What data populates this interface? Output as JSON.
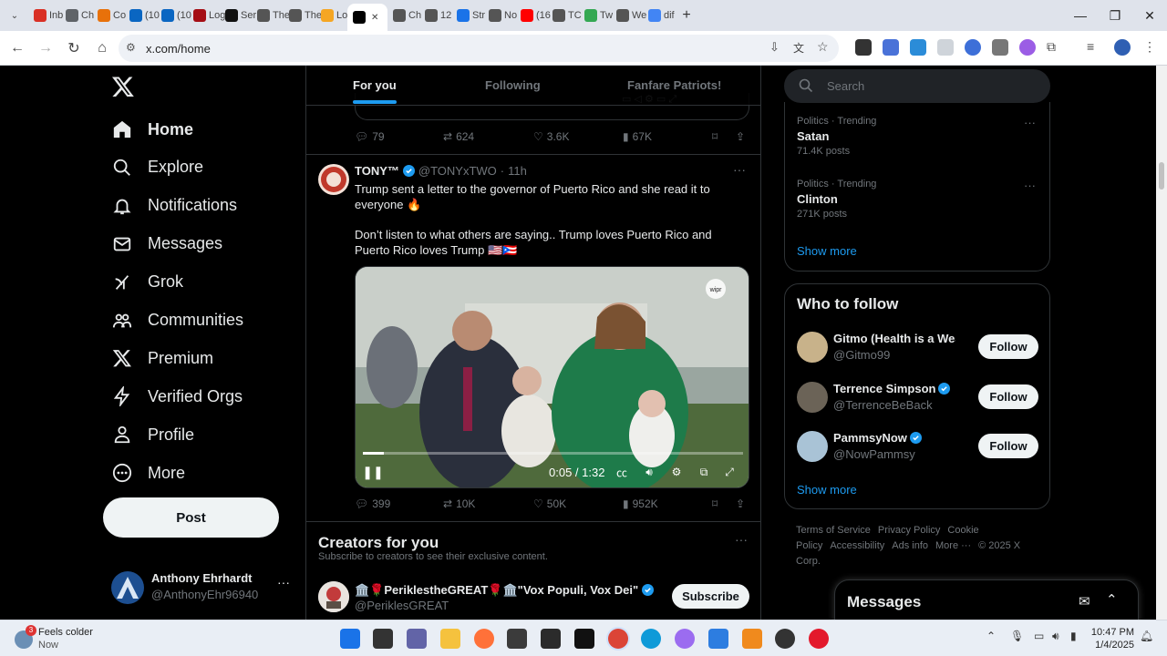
{
  "browser": {
    "tabs": [
      {
        "label": "Inb",
        "color": "#d93025"
      },
      {
        "label": "Ch",
        "color": "#5f6368"
      },
      {
        "label": "Co",
        "color": "#e8710a"
      },
      {
        "label": "(10",
        "color": "#0a66c2"
      },
      {
        "label": "(10",
        "color": "#0a66c2"
      },
      {
        "label": "Log",
        "color": "#a50e15"
      },
      {
        "label": "Ser",
        "color": "#111"
      },
      {
        "label": "The",
        "color": "#555"
      },
      {
        "label": "The",
        "color": "#555"
      },
      {
        "label": "Log",
        "color": "#f5a623"
      },
      {
        "label": "",
        "color": "#000",
        "active": true
      },
      {
        "label": "Ch",
        "color": "#555"
      },
      {
        "label": "12",
        "color": "#555"
      },
      {
        "label": "Str",
        "color": "#1a73e8"
      },
      {
        "label": "No",
        "color": "#555"
      },
      {
        "label": "(16",
        "color": "#ff0000"
      },
      {
        "label": "TC",
        "color": "#555"
      },
      {
        "label": "Tw",
        "color": "#34a853"
      },
      {
        "label": "We",
        "color": "#555"
      },
      {
        "label": "dif",
        "color": "#4285f4"
      }
    ],
    "url": "x.com/home"
  },
  "nav": {
    "items": [
      {
        "label": "Home",
        "icon": "home-icon"
      },
      {
        "label": "Explore",
        "icon": "search-icon"
      },
      {
        "label": "Notifications",
        "icon": "bell-icon"
      },
      {
        "label": "Messages",
        "icon": "envelope-icon"
      },
      {
        "label": "Grok",
        "icon": "grok-icon"
      },
      {
        "label": "Communities",
        "icon": "people-icon"
      },
      {
        "label": "Premium",
        "icon": "x-logo-icon"
      },
      {
        "label": "Verified Orgs",
        "icon": "bolt-icon"
      },
      {
        "label": "Profile",
        "icon": "person-icon"
      },
      {
        "label": "More",
        "icon": "more-circle-icon"
      }
    ],
    "post_label": "Post"
  },
  "account": {
    "name": "Anthony Ehrhardt",
    "handle": "@AnthonyEhr96940"
  },
  "feed_tabs": [
    "For you",
    "Following",
    "Fanfare Patriots!"
  ],
  "prev_tweet": {
    "replies": "79",
    "reposts": "624",
    "likes": "3.6K",
    "views": "67K"
  },
  "tweet": {
    "name": "TONY™",
    "handle": "@TONYxTWO",
    "time": "11h",
    "text1": "Trump sent a letter to the governor of Puerto Rico and she read it to everyone 🔥",
    "text2": "Don’t listen to what others are saying.. Trump loves Puerto Rico and Puerto Rico loves Trump 🇺🇸🇵🇷",
    "video_time": "0:05 / 1:32",
    "video_progress": 0.054,
    "video_watermark": "wipr",
    "replies": "399",
    "reposts": "10K",
    "likes": "50K",
    "views": "952K"
  },
  "creators": {
    "title": "Creators for you",
    "subtitle": "Subscribe to creators to see their exclusive content.",
    "item": {
      "name": "🏛️🌹PeriklestheGREAT🌹🏛️\"Vox Populi, Vox Dei\"",
      "handle": "@PeriklesGREAT",
      "button": "Subscribe"
    }
  },
  "search": {
    "placeholder": "Search"
  },
  "trends": [
    {
      "category": "Politics · Trending",
      "title": "Satan",
      "count": "71.4K posts"
    },
    {
      "category": "Politics · Trending",
      "title": "Clinton",
      "count": "271K posts"
    }
  ],
  "trends_show_more": "Show more",
  "who_to_follow": {
    "title": "Who to follow",
    "items": [
      {
        "name": "Gitmo (Health is a Wea",
        "handle": "@Gitmo99",
        "button": "Follow",
        "avatar_color": "#c8b28a"
      },
      {
        "name": "Terrence Simpson",
        "handle": "@TerrenceBeBack",
        "button": "Follow",
        "avatar_color": "#6b6357"
      },
      {
        "name": "PammsyNow",
        "handle": "@NowPammsy",
        "button": "Follow",
        "avatar_color": "#a9c3d6"
      }
    ],
    "show_more": "Show more"
  },
  "footer": {
    "links": [
      "Terms of Service",
      "Privacy Policy",
      "Cookie Policy",
      "Accessibility",
      "Ads info",
      "More ···",
      "© 2025 X Corp."
    ]
  },
  "messages_panel": {
    "title": "Messages"
  },
  "taskbar": {
    "weather_title": "Feels colder",
    "weather_sub": "Now",
    "weather_badge": "3",
    "time": "10:47 PM",
    "date": "1/4/2025"
  },
  "colors": {
    "accent": "#1d9bf0",
    "bg": "#000000",
    "text": "#e7e9ea",
    "muted": "#71767b"
  }
}
